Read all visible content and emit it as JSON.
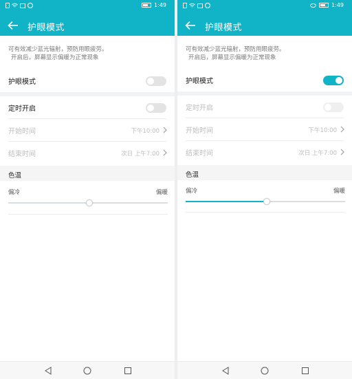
{
  "screens": [
    {
      "status": {
        "time": "1:49"
      },
      "header": {
        "title": "护眼模式"
      },
      "description": {
        "line1": "可有效减少蓝光辐射，预防用眼疲劳。",
        "line2": "开启后，屏幕显示偏暖为正常现象"
      },
      "eye_mode": {
        "label": "护眼模式",
        "enabled": false
      },
      "schedule": {
        "label": "定时开启",
        "enabled": false,
        "disabled_row": false
      },
      "start_time": {
        "label": "开始时间",
        "value": "下午10:00"
      },
      "end_time": {
        "label": "结束时间",
        "value": "次日 上午7:00"
      },
      "color_temp": {
        "section_label": "色温",
        "cool_label": "偏冷",
        "warm_label": "偏暖",
        "level_fraction": 0.51,
        "slider_color": "#d6dde3"
      }
    },
    {
      "status": {
        "time": "1:49"
      },
      "header": {
        "title": "护眼模式"
      },
      "description": {
        "line1": "可有效减少蓝光辐射，预防用眼疲劳。",
        "line2": "开启后，屏幕显示偏暖为正常现象"
      },
      "eye_mode": {
        "label": "护眼模式",
        "enabled": true
      },
      "schedule": {
        "label": "定时开启",
        "enabled": false,
        "disabled_row": true
      },
      "start_time": {
        "label": "开始时间",
        "value": "下午10:00"
      },
      "end_time": {
        "label": "结束时间",
        "value": "次日 上午7:00"
      },
      "color_temp": {
        "section_label": "色温",
        "cool_label": "偏冷",
        "warm_label": "偏暖",
        "level_fraction": 0.51,
        "slider_color": "#11b3c7"
      }
    }
  ],
  "colors": {
    "accent": "#11b3c7",
    "toggle_off": "#e3e3e3"
  },
  "icons": {
    "back": "arrow-left-icon",
    "nav_back": "triangle-back-icon",
    "nav_home": "circle-home-icon",
    "nav_recent": "square-recent-icon"
  }
}
